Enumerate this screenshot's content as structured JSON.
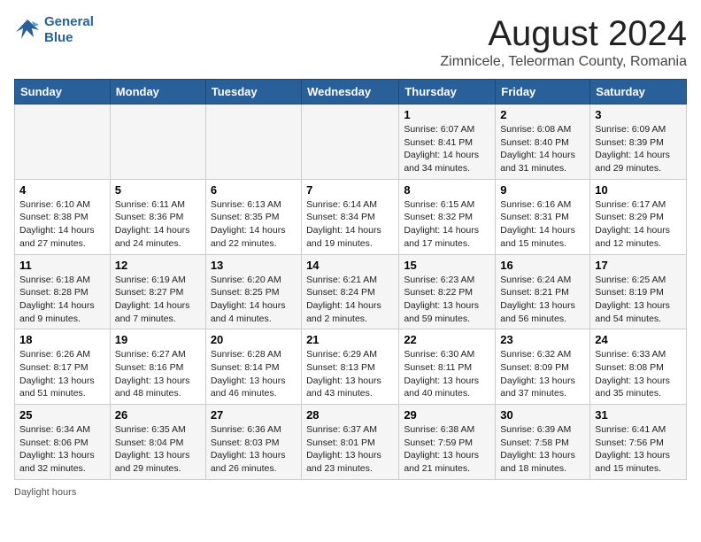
{
  "logo": {
    "line1": "General",
    "line2": "Blue"
  },
  "title": "August 2024",
  "location": "Zimnicele, Teleorman County, Romania",
  "days_of_week": [
    "Sunday",
    "Monday",
    "Tuesday",
    "Wednesday",
    "Thursday",
    "Friday",
    "Saturday"
  ],
  "weeks": [
    [
      {
        "day": "",
        "info": ""
      },
      {
        "day": "",
        "info": ""
      },
      {
        "day": "",
        "info": ""
      },
      {
        "day": "",
        "info": ""
      },
      {
        "day": "1",
        "info": "Sunrise: 6:07 AM\nSunset: 8:41 PM\nDaylight: 14 hours and 34 minutes."
      },
      {
        "day": "2",
        "info": "Sunrise: 6:08 AM\nSunset: 8:40 PM\nDaylight: 14 hours and 31 minutes."
      },
      {
        "day": "3",
        "info": "Sunrise: 6:09 AM\nSunset: 8:39 PM\nDaylight: 14 hours and 29 minutes."
      }
    ],
    [
      {
        "day": "4",
        "info": "Sunrise: 6:10 AM\nSunset: 8:38 PM\nDaylight: 14 hours and 27 minutes."
      },
      {
        "day": "5",
        "info": "Sunrise: 6:11 AM\nSunset: 8:36 PM\nDaylight: 14 hours and 24 minutes."
      },
      {
        "day": "6",
        "info": "Sunrise: 6:13 AM\nSunset: 8:35 PM\nDaylight: 14 hours and 22 minutes."
      },
      {
        "day": "7",
        "info": "Sunrise: 6:14 AM\nSunset: 8:34 PM\nDaylight: 14 hours and 19 minutes."
      },
      {
        "day": "8",
        "info": "Sunrise: 6:15 AM\nSunset: 8:32 PM\nDaylight: 14 hours and 17 minutes."
      },
      {
        "day": "9",
        "info": "Sunrise: 6:16 AM\nSunset: 8:31 PM\nDaylight: 14 hours and 15 minutes."
      },
      {
        "day": "10",
        "info": "Sunrise: 6:17 AM\nSunset: 8:29 PM\nDaylight: 14 hours and 12 minutes."
      }
    ],
    [
      {
        "day": "11",
        "info": "Sunrise: 6:18 AM\nSunset: 8:28 PM\nDaylight: 14 hours and 9 minutes."
      },
      {
        "day": "12",
        "info": "Sunrise: 6:19 AM\nSunset: 8:27 PM\nDaylight: 14 hours and 7 minutes."
      },
      {
        "day": "13",
        "info": "Sunrise: 6:20 AM\nSunset: 8:25 PM\nDaylight: 14 hours and 4 minutes."
      },
      {
        "day": "14",
        "info": "Sunrise: 6:21 AM\nSunset: 8:24 PM\nDaylight: 14 hours and 2 minutes."
      },
      {
        "day": "15",
        "info": "Sunrise: 6:23 AM\nSunset: 8:22 PM\nDaylight: 13 hours and 59 minutes."
      },
      {
        "day": "16",
        "info": "Sunrise: 6:24 AM\nSunset: 8:21 PM\nDaylight: 13 hours and 56 minutes."
      },
      {
        "day": "17",
        "info": "Sunrise: 6:25 AM\nSunset: 8:19 PM\nDaylight: 13 hours and 54 minutes."
      }
    ],
    [
      {
        "day": "18",
        "info": "Sunrise: 6:26 AM\nSunset: 8:17 PM\nDaylight: 13 hours and 51 minutes."
      },
      {
        "day": "19",
        "info": "Sunrise: 6:27 AM\nSunset: 8:16 PM\nDaylight: 13 hours and 48 minutes."
      },
      {
        "day": "20",
        "info": "Sunrise: 6:28 AM\nSunset: 8:14 PM\nDaylight: 13 hours and 46 minutes."
      },
      {
        "day": "21",
        "info": "Sunrise: 6:29 AM\nSunset: 8:13 PM\nDaylight: 13 hours and 43 minutes."
      },
      {
        "day": "22",
        "info": "Sunrise: 6:30 AM\nSunset: 8:11 PM\nDaylight: 13 hours and 40 minutes."
      },
      {
        "day": "23",
        "info": "Sunrise: 6:32 AM\nSunset: 8:09 PM\nDaylight: 13 hours and 37 minutes."
      },
      {
        "day": "24",
        "info": "Sunrise: 6:33 AM\nSunset: 8:08 PM\nDaylight: 13 hours and 35 minutes."
      }
    ],
    [
      {
        "day": "25",
        "info": "Sunrise: 6:34 AM\nSunset: 8:06 PM\nDaylight: 13 hours and 32 minutes."
      },
      {
        "day": "26",
        "info": "Sunrise: 6:35 AM\nSunset: 8:04 PM\nDaylight: 13 hours and 29 minutes."
      },
      {
        "day": "27",
        "info": "Sunrise: 6:36 AM\nSunset: 8:03 PM\nDaylight: 13 hours and 26 minutes."
      },
      {
        "day": "28",
        "info": "Sunrise: 6:37 AM\nSunset: 8:01 PM\nDaylight: 13 hours and 23 minutes."
      },
      {
        "day": "29",
        "info": "Sunrise: 6:38 AM\nSunset: 7:59 PM\nDaylight: 13 hours and 21 minutes."
      },
      {
        "day": "30",
        "info": "Sunrise: 6:39 AM\nSunset: 7:58 PM\nDaylight: 13 hours and 18 minutes."
      },
      {
        "day": "31",
        "info": "Sunrise: 6:41 AM\nSunset: 7:56 PM\nDaylight: 13 hours and 15 minutes."
      }
    ]
  ],
  "footer": "Daylight hours"
}
